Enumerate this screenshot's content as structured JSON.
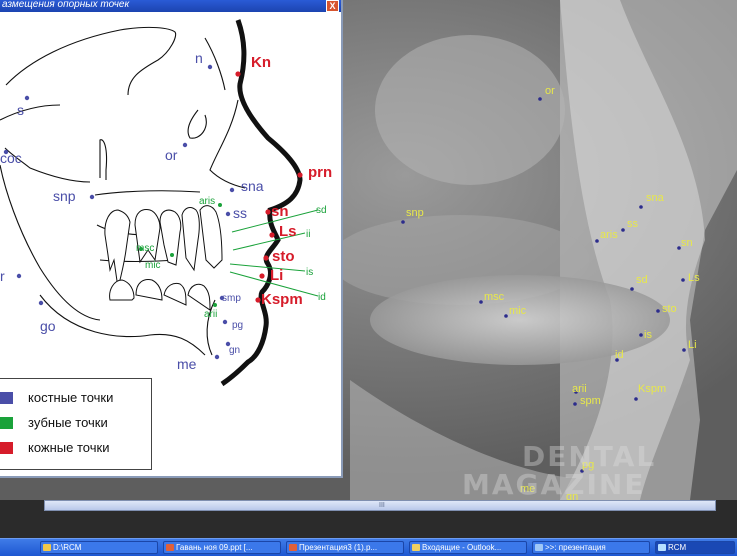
{
  "window": {
    "title": "азмещения опорных точек",
    "close_label": "X"
  },
  "diagram": {
    "bone_points": [
      "s",
      "n",
      "or",
      "coc",
      "snp",
      "sna",
      "ss",
      "r",
      "go",
      "me",
      "pg",
      "gn",
      "smp"
    ],
    "tooth_points": [
      "aris",
      "msc",
      "mic",
      "arii",
      "sd",
      "ii",
      "is",
      "id"
    ],
    "skin_points": [
      "Kn",
      "prn",
      "sn",
      "Ls",
      "sto",
      "Li",
      "Kspm"
    ]
  },
  "legend": {
    "items": [
      {
        "label": "костные точки",
        "color": "#4a4ea8"
      },
      {
        "label": "зубные точки",
        "color": "#1aa23a"
      },
      {
        "label": "кожные точки",
        "color": "#d61c2a"
      }
    ]
  },
  "xray": {
    "points": [
      "or",
      "snp",
      "sna",
      "ss",
      "aris",
      "sn",
      "sd",
      "Ls",
      "msc",
      "mic",
      "sto",
      "is",
      "id",
      "Li",
      "arii",
      "Kspm",
      "spm",
      "pg",
      "me",
      "gn"
    ],
    "watermark": {
      "line1": "DENTAL",
      "line2": "MAGAZINE"
    }
  },
  "scrollbar": {
    "grip": "III"
  },
  "taskbar": {
    "items": [
      "D:\\RCM",
      "Гавань ноя 09.ppt [...",
      "Презентация3 (1).p...",
      "Входящие - Outlook...",
      ">>: презентация",
      "RCM"
    ]
  },
  "colors": {
    "bone": "#4a4ea8",
    "tooth": "#1aa23a",
    "skin": "#d61c2a",
    "xray_label": "#e8e84a"
  }
}
